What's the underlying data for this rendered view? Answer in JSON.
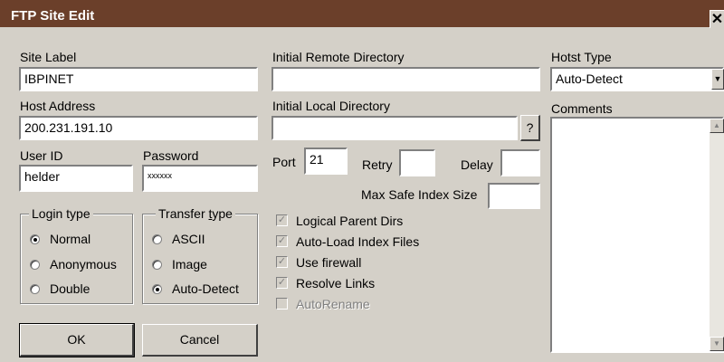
{
  "window": {
    "title": "FTP Site Edit",
    "close_glyph": "✕"
  },
  "fields": {
    "site_label": {
      "label": "Site Label",
      "value": "IBPINET"
    },
    "host_address": {
      "label": "Host Address",
      "value": "200.231.191.10"
    },
    "user_id": {
      "label": "User ID",
      "value": "helder"
    },
    "password": {
      "label": "Password",
      "value": "xxxxxx"
    },
    "initial_remote_dir": {
      "label": "Initial Remote Directory",
      "value": ""
    },
    "initial_local_dir": {
      "label": "Initial Local Directory",
      "value": "",
      "browse_label": "?"
    },
    "port": {
      "label": "Port",
      "value": "21"
    },
    "retry": {
      "label": "Retry",
      "value": ""
    },
    "delay": {
      "label": "Delay",
      "value": ""
    },
    "max_safe_index": {
      "label": "Max Safe Index Size",
      "value": ""
    },
    "host_type": {
      "label": "Hotst Type",
      "value": "Auto-Detect"
    },
    "comments": {
      "label": "Comments",
      "value": ""
    }
  },
  "login_type": {
    "label": "Login type",
    "options": [
      "Normal",
      "Anonymous",
      "Double"
    ],
    "selected": "Normal"
  },
  "transfer_type": {
    "label_prefix": "Transfer ",
    "label_underlined": "t",
    "label_suffix": "ype",
    "options": [
      "ASCII",
      "Image",
      "Auto-Detect"
    ],
    "selected": "Auto-Detect"
  },
  "checkboxes": [
    {
      "label": "Logical Parent Dirs",
      "checked": true,
      "enabled": true
    },
    {
      "label": "Auto-Load Index Files",
      "checked": true,
      "enabled": true
    },
    {
      "label": "Use firewall",
      "checked": true,
      "enabled": true
    },
    {
      "label": "Resolve Links",
      "checked": true,
      "enabled": true
    },
    {
      "label": "AutoRename",
      "checked": false,
      "enabled": false
    }
  ],
  "buttons": {
    "ok": "OK",
    "cancel": "Cancel"
  },
  "icons": {
    "dropdown": "dropdown-arrow-icon",
    "scroll_up": "scroll-up-icon",
    "scroll_down": "scroll-down-icon"
  }
}
